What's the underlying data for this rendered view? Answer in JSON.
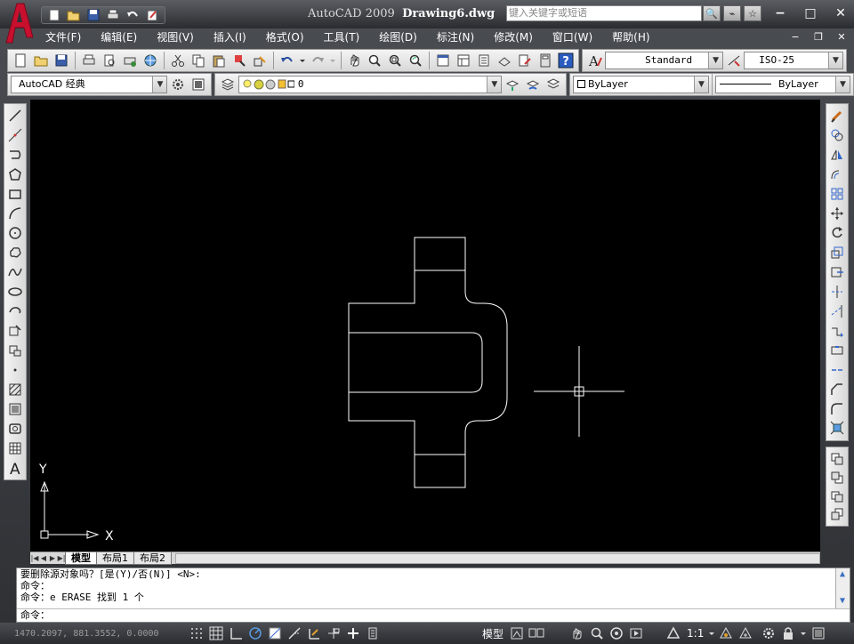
{
  "title": {
    "app": "AutoCAD 2009",
    "file": "Drawing6.dwg"
  },
  "search": {
    "placeholder": "键入关键字或短语"
  },
  "menu": [
    "文件(F)",
    "编辑(E)",
    "视图(V)",
    "插入(I)",
    "格式(O)",
    "工具(T)",
    "绘图(D)",
    "标注(N)",
    "修改(M)",
    "窗口(W)",
    "帮助(H)"
  ],
  "toolbar": {
    "text_style": "Standard",
    "dim_style": "ISO-25",
    "workspace": "AutoCAD 经典",
    "layer": "0",
    "color": "ByLayer",
    "linetype": "ByLayer"
  },
  "tabs": [
    "模型",
    "布局1",
    "布局2"
  ],
  "axis": {
    "x": "X",
    "y": "Y"
  },
  "command": {
    "lines": [
      "要删除源对象吗？[是(Y)/否(N)] <N>:",
      "命令：",
      "命令：e ERASE 找到 1 个"
    ],
    "prompt": "命令："
  },
  "status": {
    "coords": "1470.2097, 881.3552, 0.0000",
    "model_label": "模型",
    "scale": "1:1"
  },
  "colors": {
    "accent": "#c8102e",
    "canvas": "#000000",
    "line": "#ffffff"
  }
}
